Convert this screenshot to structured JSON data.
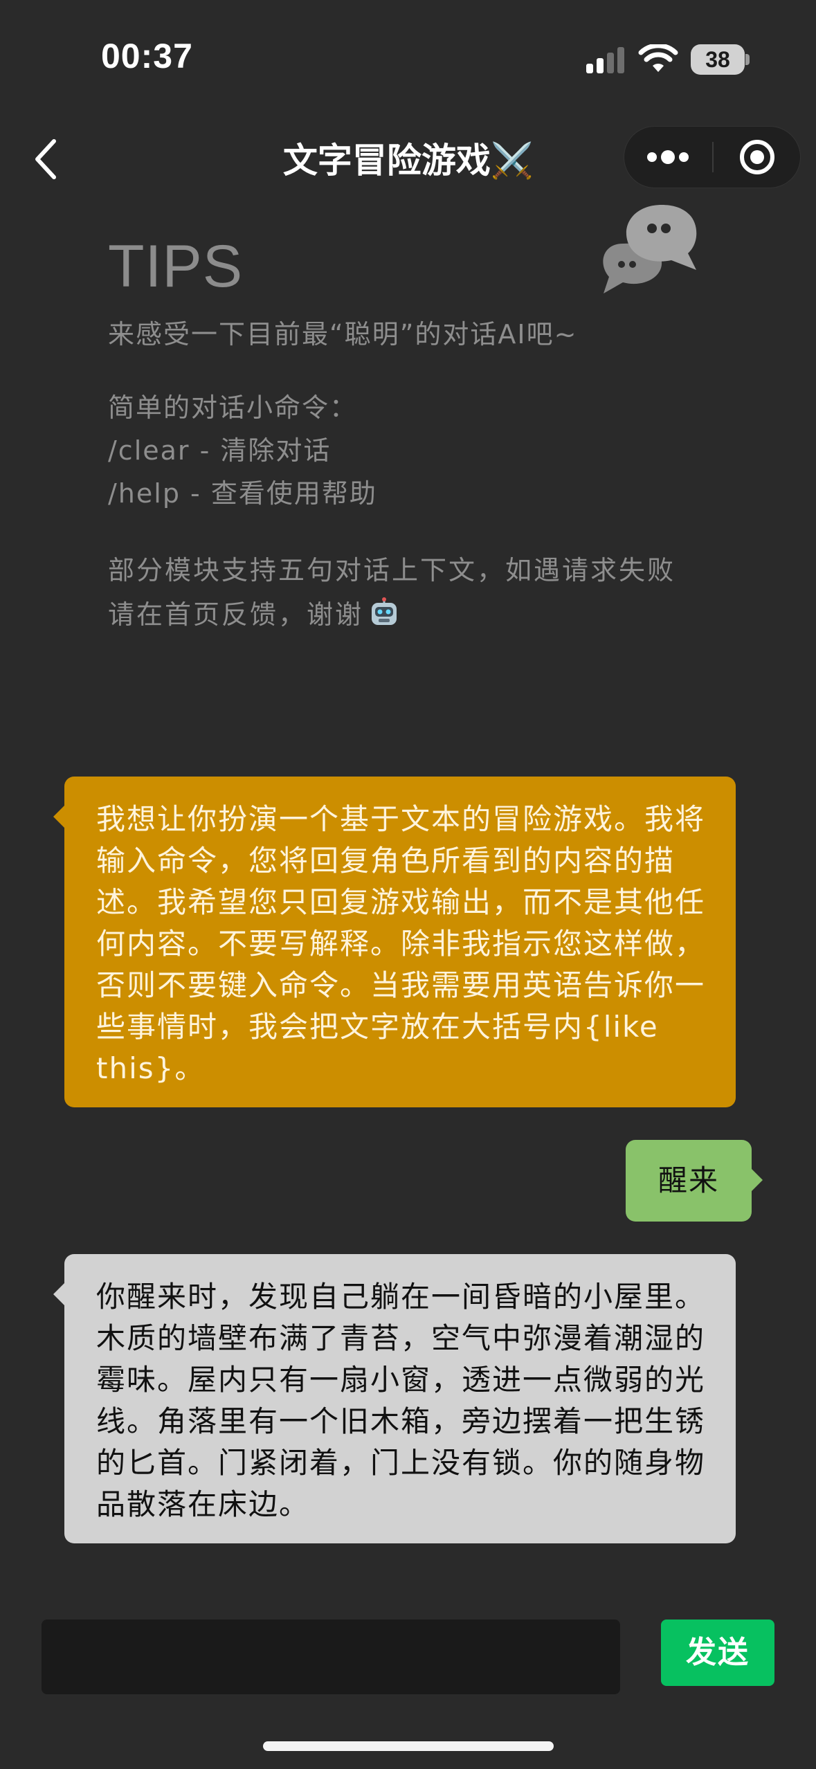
{
  "status_bar": {
    "time": "00:37",
    "battery": "38",
    "icons": [
      "signal-icon",
      "wifi-icon",
      "battery-icon"
    ]
  },
  "nav": {
    "title": "文字冒险游戏⚔️",
    "icons": [
      "back-chevron-icon",
      "more-dots-icon",
      "close-target-icon"
    ]
  },
  "tips": {
    "title": "TIPS",
    "subtitle": "来感受一下目前最“聪明”的对话AI吧~",
    "commands_header": "简单的对话小命令：",
    "commands": [
      "/clear - 清除对话",
      "/help - 查看使用帮助"
    ],
    "note": "部分模块支持五句对话上下文，如遇请求失败请在首页反馈，谢谢",
    "icons": [
      "chat-bubbles-icon",
      "robot-emoji-icon"
    ]
  },
  "chat": {
    "messages": [
      {
        "sender": "bot",
        "text": "我想让你扮演一个基于文本的冒险游戏。我将输入命令，您将回复角色所看到的内容的描述。我希望您只回复游戏输出，而不是其他任何内容。不要写解释。除非我指示您这样做，否则不要键入命令。当我需要用英语告诉你一些事情时，我会把文字放在大括号内{like this}。"
      },
      {
        "sender": "user",
        "text": "醒来"
      },
      {
        "sender": "bot",
        "text": "你醒来时，发现自己躺在一间昏暗的小屋里。木质的墙壁布满了青苔，空气中弥漫着潮湿的霉味。屋内只有一扇小窗，透进一点微弱的光线。角落里有一个旧木箱，旁边摆着一把生锈的匕首。门紧闭着，门上没有锁。你的随身物品散落在床边。"
      }
    ]
  },
  "input_bar": {
    "value": "",
    "send_label": "发送"
  },
  "colors": {
    "background": "#2a2a2a",
    "bot_prompt_bubble": "#cc8e00",
    "user_bubble": "#89c26a",
    "bot_reply_bubble": "#d2d2d2",
    "send_button": "#07c160"
  }
}
